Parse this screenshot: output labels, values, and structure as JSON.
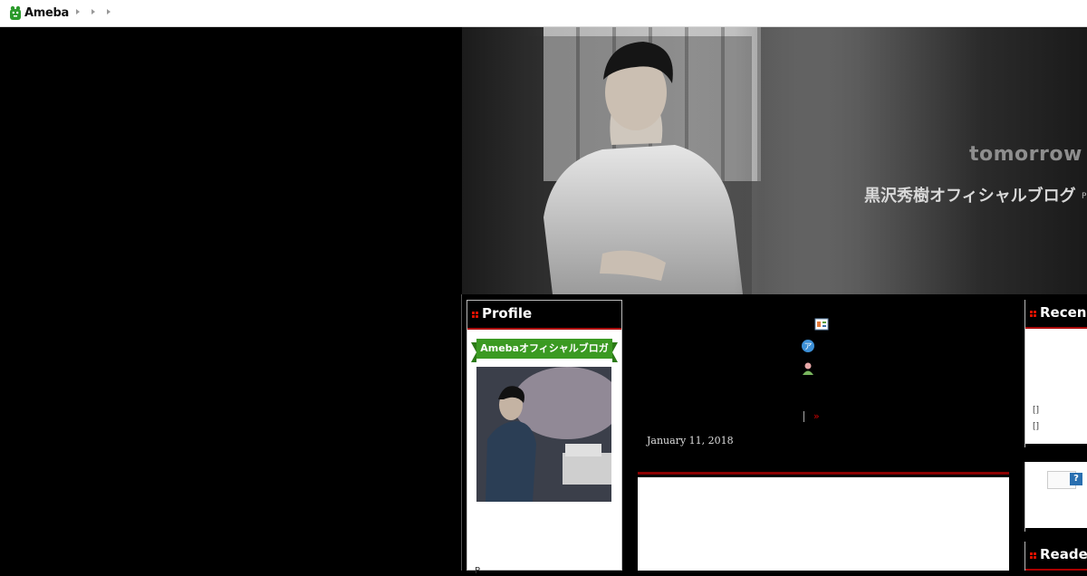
{
  "topbar": {
    "logo_text": "Ameba",
    "breadcrumbs": [
      "",
      "",
      ""
    ]
  },
  "header": {
    "tagline": "tomorrow",
    "blog_title": "黒沢秀樹オフィシャルブログ",
    "blog_title_extra": "P"
  },
  "profile": {
    "heading": "Profile",
    "badge": "Amebaオフィシャルブロガー",
    "name_initial": "P"
  },
  "post": {
    "pager_next": "»",
    "date": "January 11, 2018"
  },
  "sidebar_right": {
    "recent_heading": "Recen",
    "recent_items": [
      "[]",
      "[]"
    ],
    "search_help": "?",
    "reader_heading": "Reade"
  },
  "colors": {
    "accent_red": "#a00000",
    "badge_green": "#3b9a22",
    "page_bg": "#000000"
  }
}
